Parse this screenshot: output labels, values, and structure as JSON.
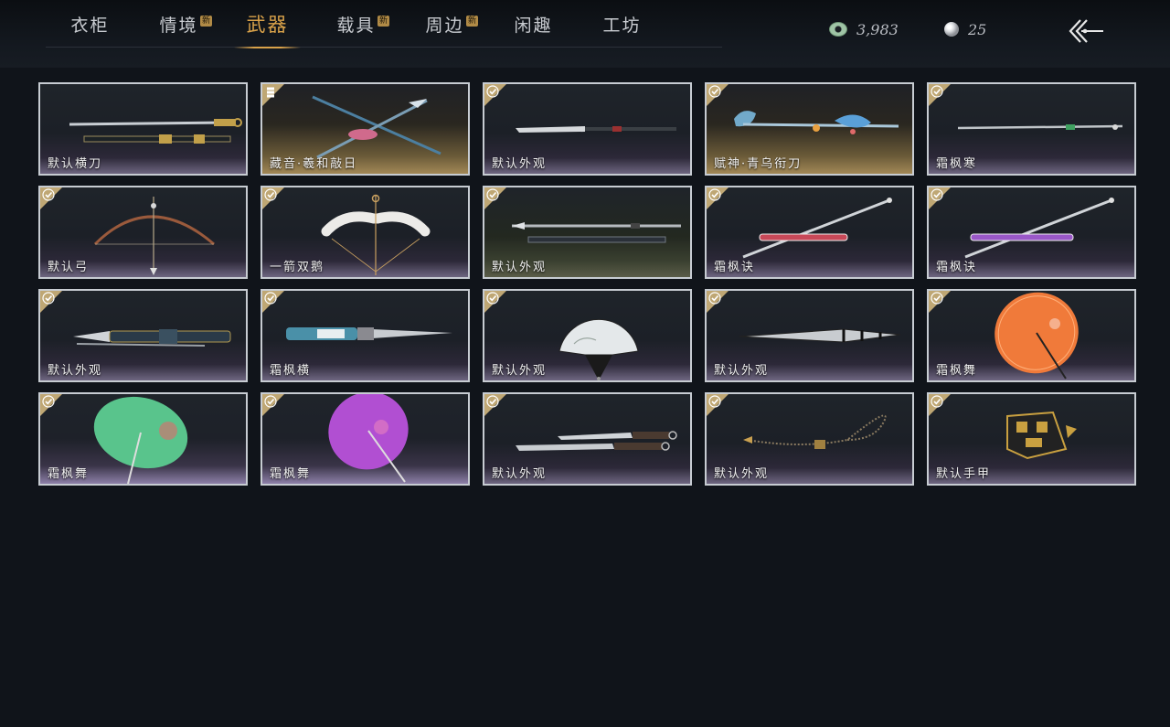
{
  "tabs": [
    {
      "label": "衣柜",
      "badge": ""
    },
    {
      "label": "情境",
      "badge": "新"
    },
    {
      "label": "武器",
      "badge": "",
      "active": true
    },
    {
      "label": "载具",
      "badge": "新"
    },
    {
      "label": "周边",
      "badge": "新"
    },
    {
      "label": "闲趣",
      "badge": ""
    },
    {
      "label": "工坊",
      "badge": ""
    }
  ],
  "currency": {
    "coin": {
      "icon": "jade-coin-icon",
      "value": "3,983"
    },
    "pearl": {
      "icon": "pearl-icon",
      "value": "25"
    }
  },
  "back_icon": "back-arrow-icon",
  "items": [
    {
      "name": "默认横刀",
      "corner": "none",
      "art": "saber-sheath",
      "bg": "default"
    },
    {
      "name": "藏音·羲和敲日",
      "corner": "stack",
      "art": "crossed-spears",
      "bg": "gold"
    },
    {
      "name": "默认外观",
      "corner": "check",
      "art": "long-blade",
      "bg": "default"
    },
    {
      "name": "赋神·青乌衔刀",
      "corner": "check",
      "art": "glacier-blade",
      "bg": "gold"
    },
    {
      "name": "霜枫寒",
      "corner": "check",
      "art": "thin-sword",
      "bg": "default"
    },
    {
      "name": "默认弓",
      "corner": "check",
      "art": "bow-wood",
      "bg": "default"
    },
    {
      "name": "一箭双鹅",
      "corner": "check",
      "art": "bow-white",
      "bg": "default"
    },
    {
      "name": "默认外观",
      "corner": "check",
      "art": "spear-pair",
      "bg": "olive"
    },
    {
      "name": "霜枫诀",
      "corner": "check",
      "art": "sword-red",
      "bg": "default"
    },
    {
      "name": "霜枫诀",
      "corner": "check",
      "art": "sword-purple",
      "bg": "default"
    },
    {
      "name": "默认外观",
      "corner": "check",
      "art": "dagger-blue",
      "bg": "default"
    },
    {
      "name": "霜枫横",
      "corner": "check",
      "art": "dagger-teal",
      "bg": "default"
    },
    {
      "name": "默认外观",
      "corner": "check",
      "art": "fan-open",
      "bg": "default"
    },
    {
      "name": "默认外观",
      "corner": "check",
      "art": "fan-closed",
      "bg": "default"
    },
    {
      "name": "霜枫舞",
      "corner": "check",
      "art": "umbrella-orange",
      "bg": "default"
    },
    {
      "name": "霜枫舞",
      "corner": "check",
      "art": "umbrella-green",
      "bg": "purple-low"
    },
    {
      "name": "霜枫舞",
      "corner": "check",
      "art": "umbrella-purple",
      "bg": "purple-low"
    },
    {
      "name": "默认外观",
      "corner": "check",
      "art": "twin-blades",
      "bg": "default"
    },
    {
      "name": "默认外观",
      "corner": "check",
      "art": "rope-dart",
      "bg": "default"
    },
    {
      "name": "默认手甲",
      "corner": "check",
      "art": "gauntlet",
      "bg": "default"
    }
  ],
  "colors": {
    "accent": "#d9a24a",
    "corner_gold": "#bfa774",
    "card_border": "#c7ccd2",
    "background": "#10141a"
  }
}
